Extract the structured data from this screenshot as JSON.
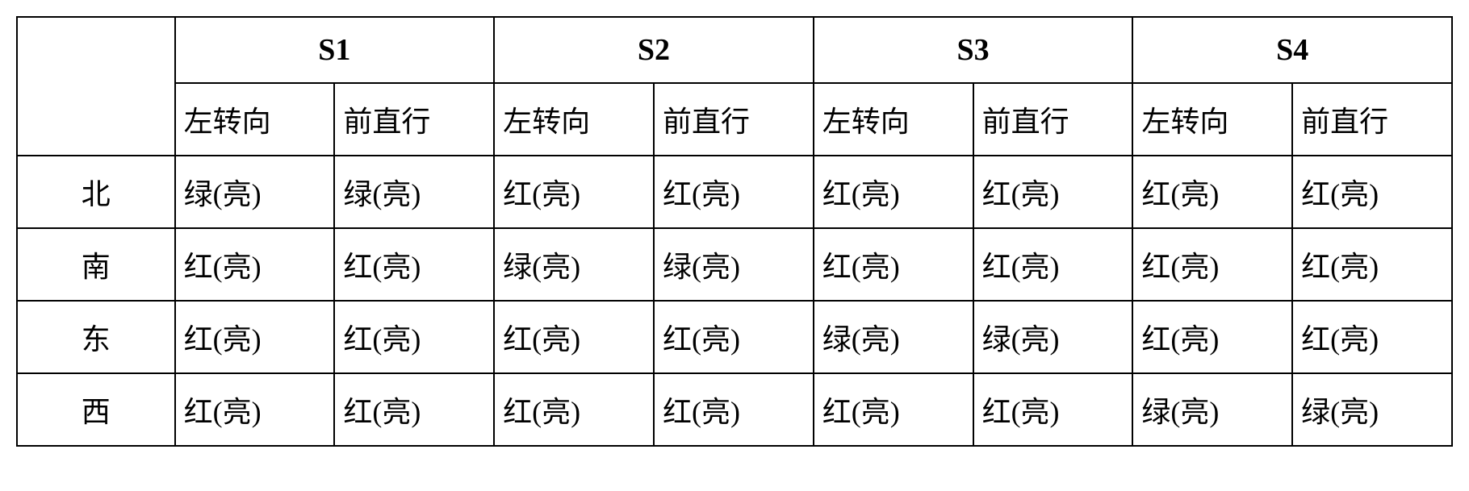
{
  "chart_data": {
    "type": "table",
    "phases": [
      "S1",
      "S2",
      "S3",
      "S4"
    ],
    "sub_headers": [
      "左转向",
      "前直行"
    ],
    "directions": [
      "北",
      "南",
      "东",
      "西"
    ],
    "cells": {
      "北": {
        "S1": {
          "左转向": "绿(亮)",
          "前直行": "绿(亮)"
        },
        "S2": {
          "左转向": "红(亮)",
          "前直行": "红(亮)"
        },
        "S3": {
          "左转向": "红(亮)",
          "前直行": "红(亮)"
        },
        "S4": {
          "左转向": "红(亮)",
          "前直行": "红(亮)"
        }
      },
      "南": {
        "S1": {
          "左转向": "红(亮)",
          "前直行": "红(亮)"
        },
        "S2": {
          "左转向": "绿(亮)",
          "前直行": "绿(亮)"
        },
        "S3": {
          "左转向": "红(亮)",
          "前直行": "红(亮)"
        },
        "S4": {
          "左转向": "红(亮)",
          "前直行": "红(亮)"
        }
      },
      "东": {
        "S1": {
          "左转向": "红(亮)",
          "前直行": "红(亮)"
        },
        "S2": {
          "左转向": "红(亮)",
          "前直行": "红(亮)"
        },
        "S3": {
          "左转向": "绿(亮)",
          "前直行": "绿(亮)"
        },
        "S4": {
          "左转向": "红(亮)",
          "前直行": "红(亮)"
        }
      },
      "西": {
        "S1": {
          "左转向": "红(亮)",
          "前直行": "红(亮)"
        },
        "S2": {
          "左转向": "红(亮)",
          "前直行": "红(亮)"
        },
        "S3": {
          "左转向": "红(亮)",
          "前直行": "红(亮)"
        },
        "S4": {
          "左转向": "绿(亮)",
          "前直行": "绿(亮)"
        }
      }
    }
  }
}
